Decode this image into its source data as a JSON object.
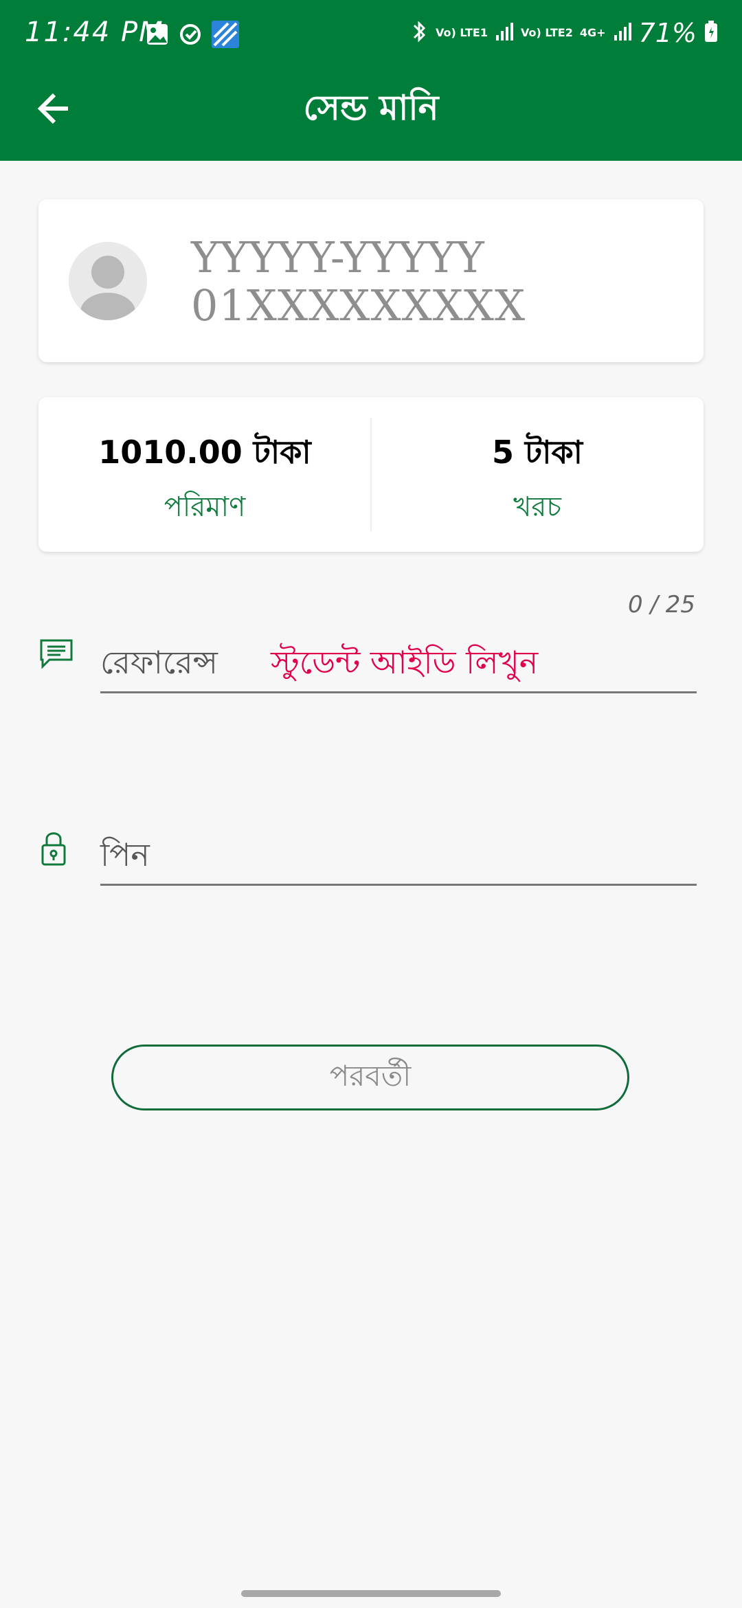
{
  "status_bar": {
    "time": "11:44 PM",
    "network_1": "Vo) LTE1",
    "network_2": "Vo) LTE2",
    "network_3": "4G+",
    "battery": "71%"
  },
  "toolbar": {
    "title": "সেন্ড মানি",
    "back_icon": "arrow-left-icon"
  },
  "recipient": {
    "name": "YYYYY-YYYYY",
    "number": "01XXXXXXXXX",
    "avatar_icon": "person-avatar-icon"
  },
  "transaction": {
    "amount_value": "1010.00 টাকা",
    "amount_label": "পরিমাণ",
    "charge_value": "5 টাকা",
    "charge_label": "খরচ"
  },
  "reference": {
    "counter": "0 / 25",
    "label": "রেফারেন্স",
    "hint": "স্টুডেন্ট আইডি লিখুন",
    "icon": "message-icon"
  },
  "pin": {
    "label": "পিন",
    "icon": "lock-icon"
  },
  "actions": {
    "next_label": "পরবর্তী"
  },
  "colors": {
    "brand_green": "#007d38",
    "label_green": "#0f7a3c",
    "hint_pink": "#e0004d"
  }
}
